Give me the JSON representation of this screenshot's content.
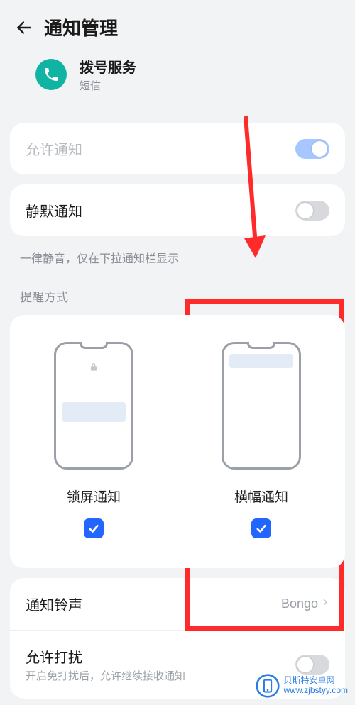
{
  "header": {
    "title": "通知管理"
  },
  "app": {
    "name": "拨号服务",
    "sub": "短信",
    "icon": "phone-icon",
    "icon_bg": "#0fb5a2"
  },
  "rows": {
    "allow_notify": {
      "label": "允许通知",
      "on": true,
      "disabled_tint": true
    },
    "silent_notify": {
      "label": "静默通知",
      "on": false
    }
  },
  "silent_desc": "一律静音，仅在下拉通知栏显示",
  "section_label": "提醒方式",
  "options": {
    "lockscreen": {
      "label": "锁屏通知",
      "checked": true
    },
    "banner": {
      "label": "横幅通知",
      "checked": true
    }
  },
  "list": {
    "ringtone": {
      "label": "通知铃声",
      "value": "Bongo"
    },
    "allow_disturb": {
      "label": "允许打扰",
      "sub": "开启免打扰后，允许继续接收通知",
      "on": false
    }
  },
  "accent": {
    "blue_check": "#2266ff",
    "toggle_on": "#a6c7ff",
    "highlight": "#ff2a2a"
  },
  "watermark": {
    "line1": "贝斯特安卓网",
    "line2": "www.zjbstyy.com"
  }
}
